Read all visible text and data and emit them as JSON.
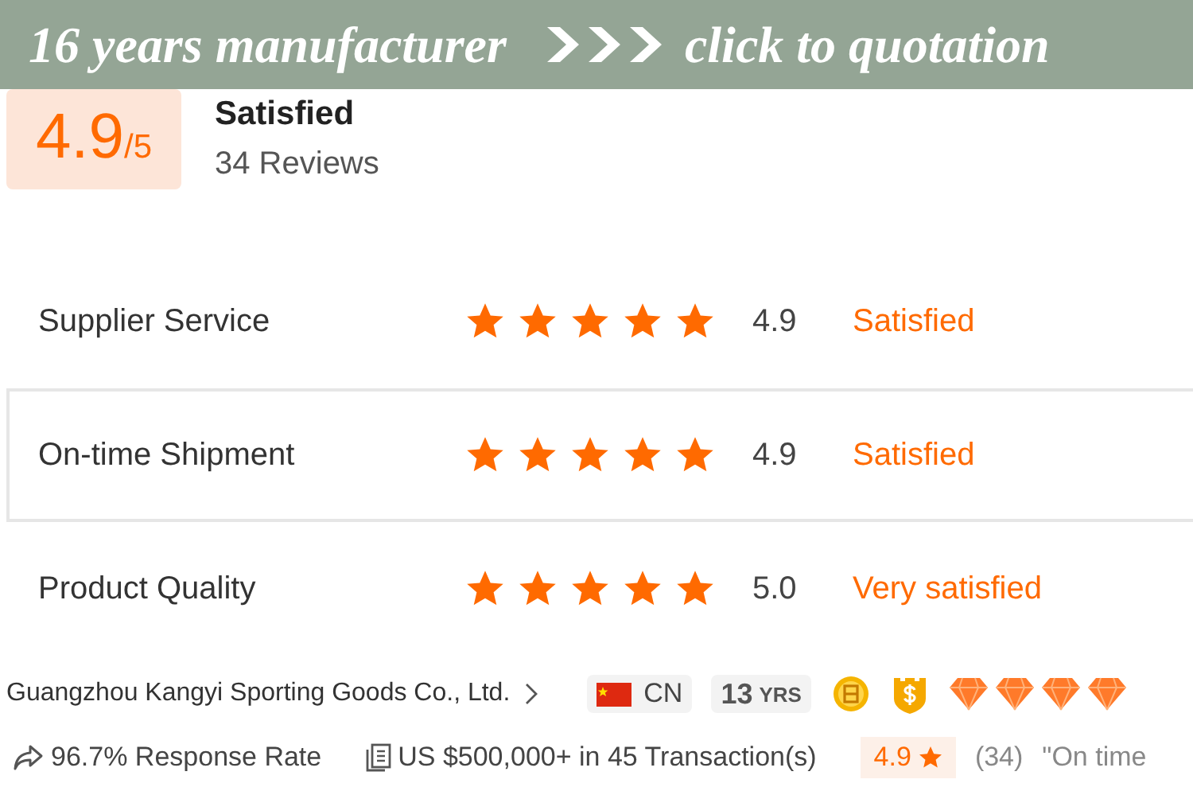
{
  "banner": {
    "left_text": "16 years manufacturer",
    "right_text": "click to quotation"
  },
  "overall": {
    "score": "4.9",
    "out_of": "/5",
    "verdict": "Satisfied",
    "reviews": "34 Reviews"
  },
  "ratings": [
    {
      "label": "Supplier Service",
      "stars": 5,
      "score": "4.9",
      "verdict": "Satisfied",
      "selected": false
    },
    {
      "label": "On-time Shipment",
      "stars": 5,
      "score": "4.9",
      "verdict": "Satisfied",
      "selected": true
    },
    {
      "label": "Product Quality",
      "stars": 5,
      "score": "5.0",
      "verdict": "Very satisfied",
      "selected": false
    }
  ],
  "supplier": {
    "name": "Guangzhou Kangyi Sporting Goods Co., Ltd.",
    "country": "CN",
    "years": "13",
    "years_unit": "YRS",
    "badges": [
      {
        "kind": "coin"
      },
      {
        "kind": "shield"
      },
      {
        "kind": "diamond"
      },
      {
        "kind": "diamond"
      },
      {
        "kind": "diamond"
      },
      {
        "kind": "diamond"
      }
    ]
  },
  "stats": {
    "response_rate": "96.7% Response Rate",
    "transactions": "US $500,000+ in 45 Transaction(s)",
    "rating": "4.9",
    "rating_count": "(34)",
    "quote": "\"On time"
  }
}
